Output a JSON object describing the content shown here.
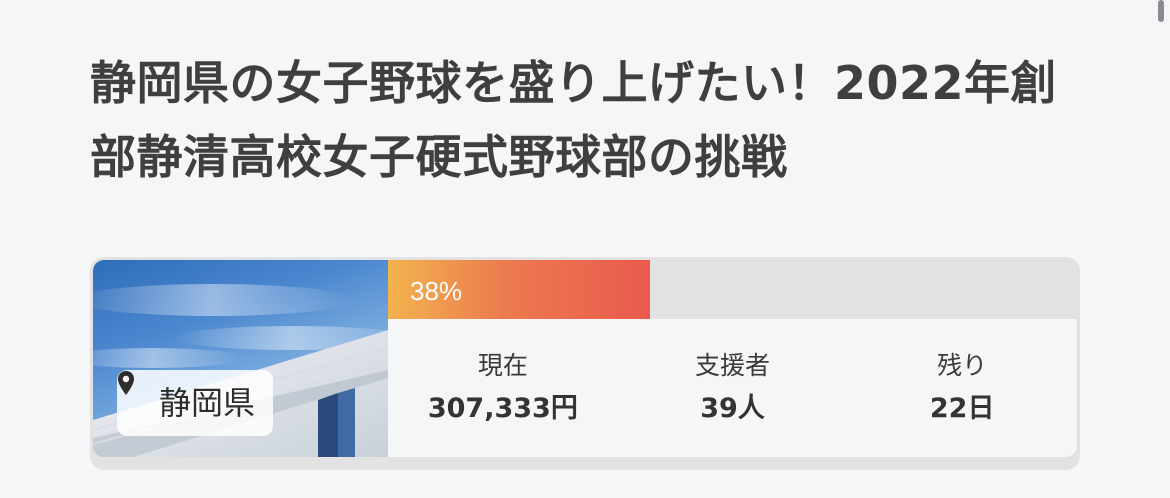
{
  "project": {
    "title": "静岡県の女子野球を盛り上げたい！2022年創部静清高校女子硬式野球部の挑戦"
  },
  "card": {
    "location": {
      "icon": "map-pin-icon",
      "label": "静岡県"
    },
    "progress": {
      "percent": 38,
      "label": "38%",
      "gradient_colors": [
        "#f2b34d",
        "#ea5a4e"
      ]
    },
    "stats": [
      {
        "label": "現在",
        "value": "307,333円"
      },
      {
        "label": "支援者",
        "value": "39人"
      },
      {
        "label": "残り",
        "value": "22日"
      }
    ]
  }
}
